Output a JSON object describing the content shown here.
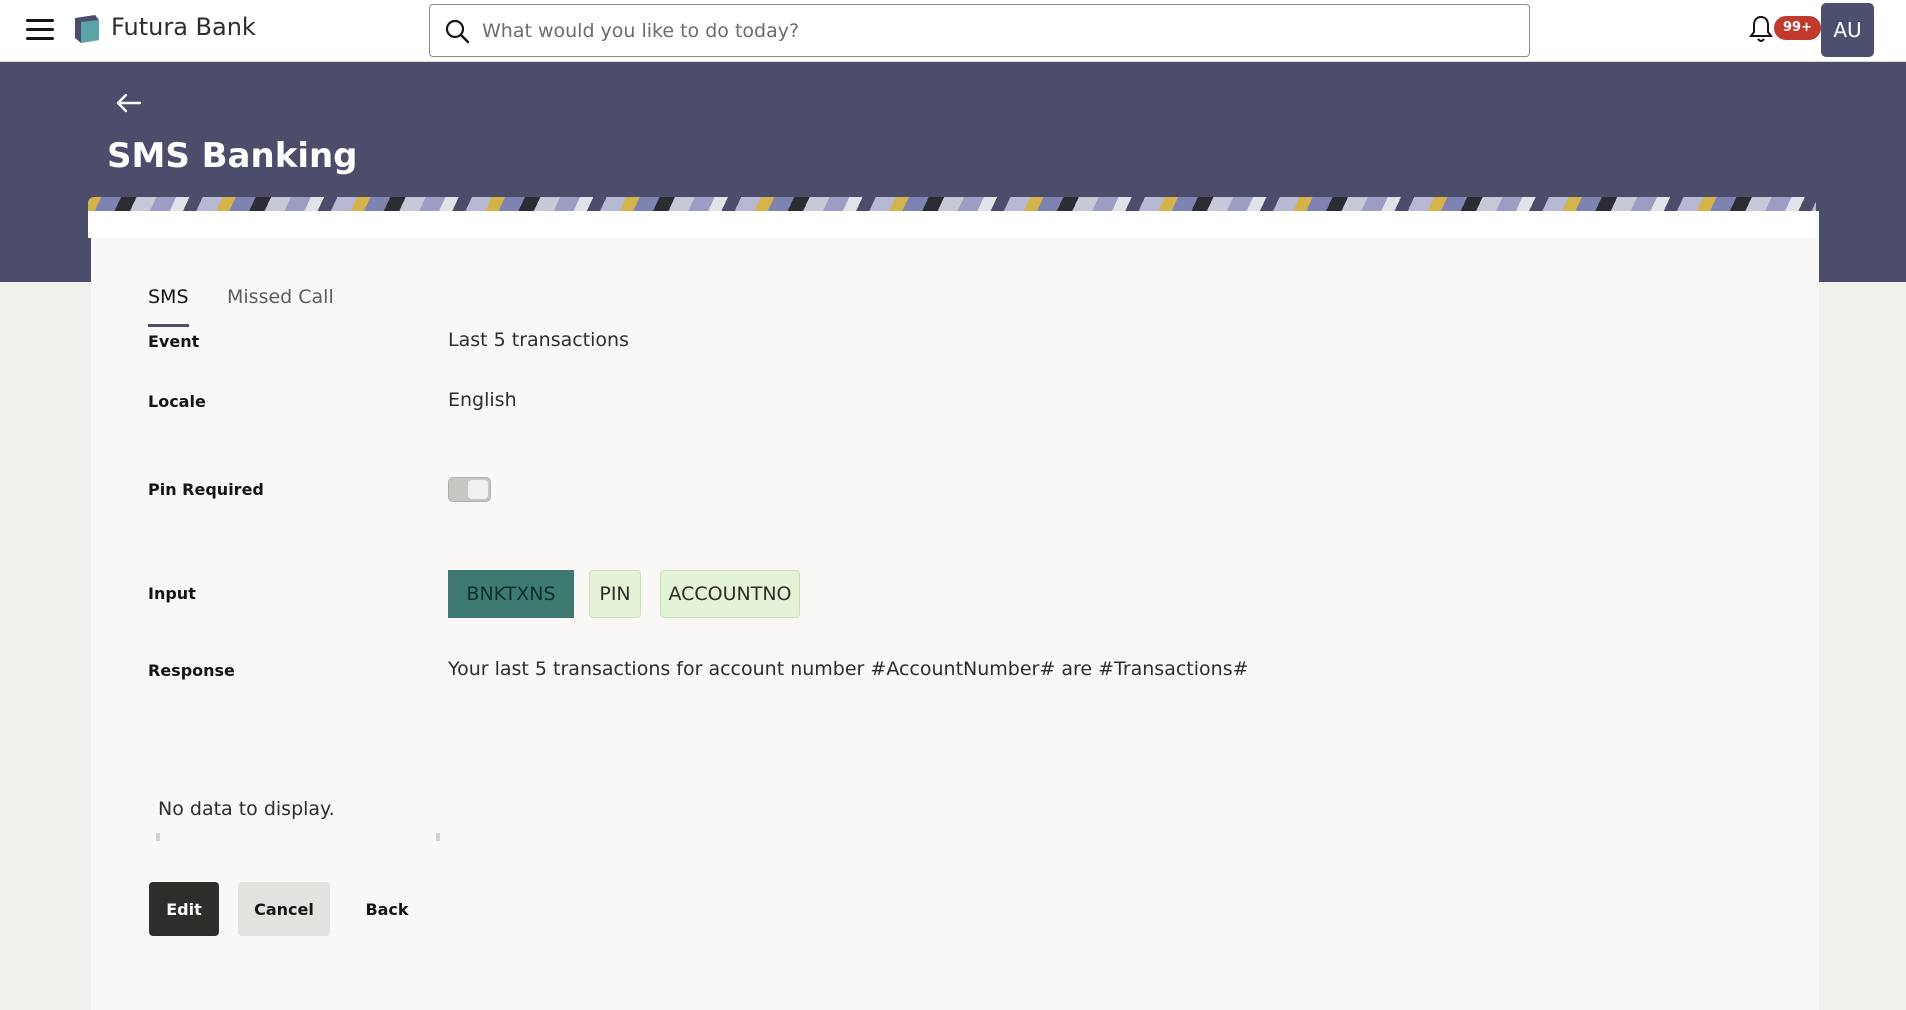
{
  "header": {
    "brand": "Futura Bank",
    "search_placeholder": "What would you like to do today?",
    "notification_count": "99+",
    "avatar_initials": "AU"
  },
  "page": {
    "title": "SMS Banking"
  },
  "tabs": [
    {
      "label": "SMS",
      "active": true
    },
    {
      "label": "Missed Call",
      "active": false
    }
  ],
  "form": {
    "event_label": "Event",
    "event_value": "Last 5 transactions",
    "locale_label": "Locale",
    "locale_value": "English",
    "pin_label": "Pin Required",
    "pin_required": false,
    "input_label": "Input",
    "input_chips": [
      "BNKTXNS",
      "PIN",
      "ACCOUNTNO"
    ],
    "response_label": "Response",
    "response_value": "Your last 5 transactions for account number #AccountNumber# are #Transactions#"
  },
  "table": {
    "empty_message": "No data to display."
  },
  "actions": {
    "edit": "Edit",
    "cancel": "Cancel",
    "back": "Back"
  },
  "colors": {
    "band": "#4b4d6a",
    "chip_active": "#3e7a71",
    "chip_inactive": "#e4f3d8",
    "badge": "#c0392b"
  }
}
